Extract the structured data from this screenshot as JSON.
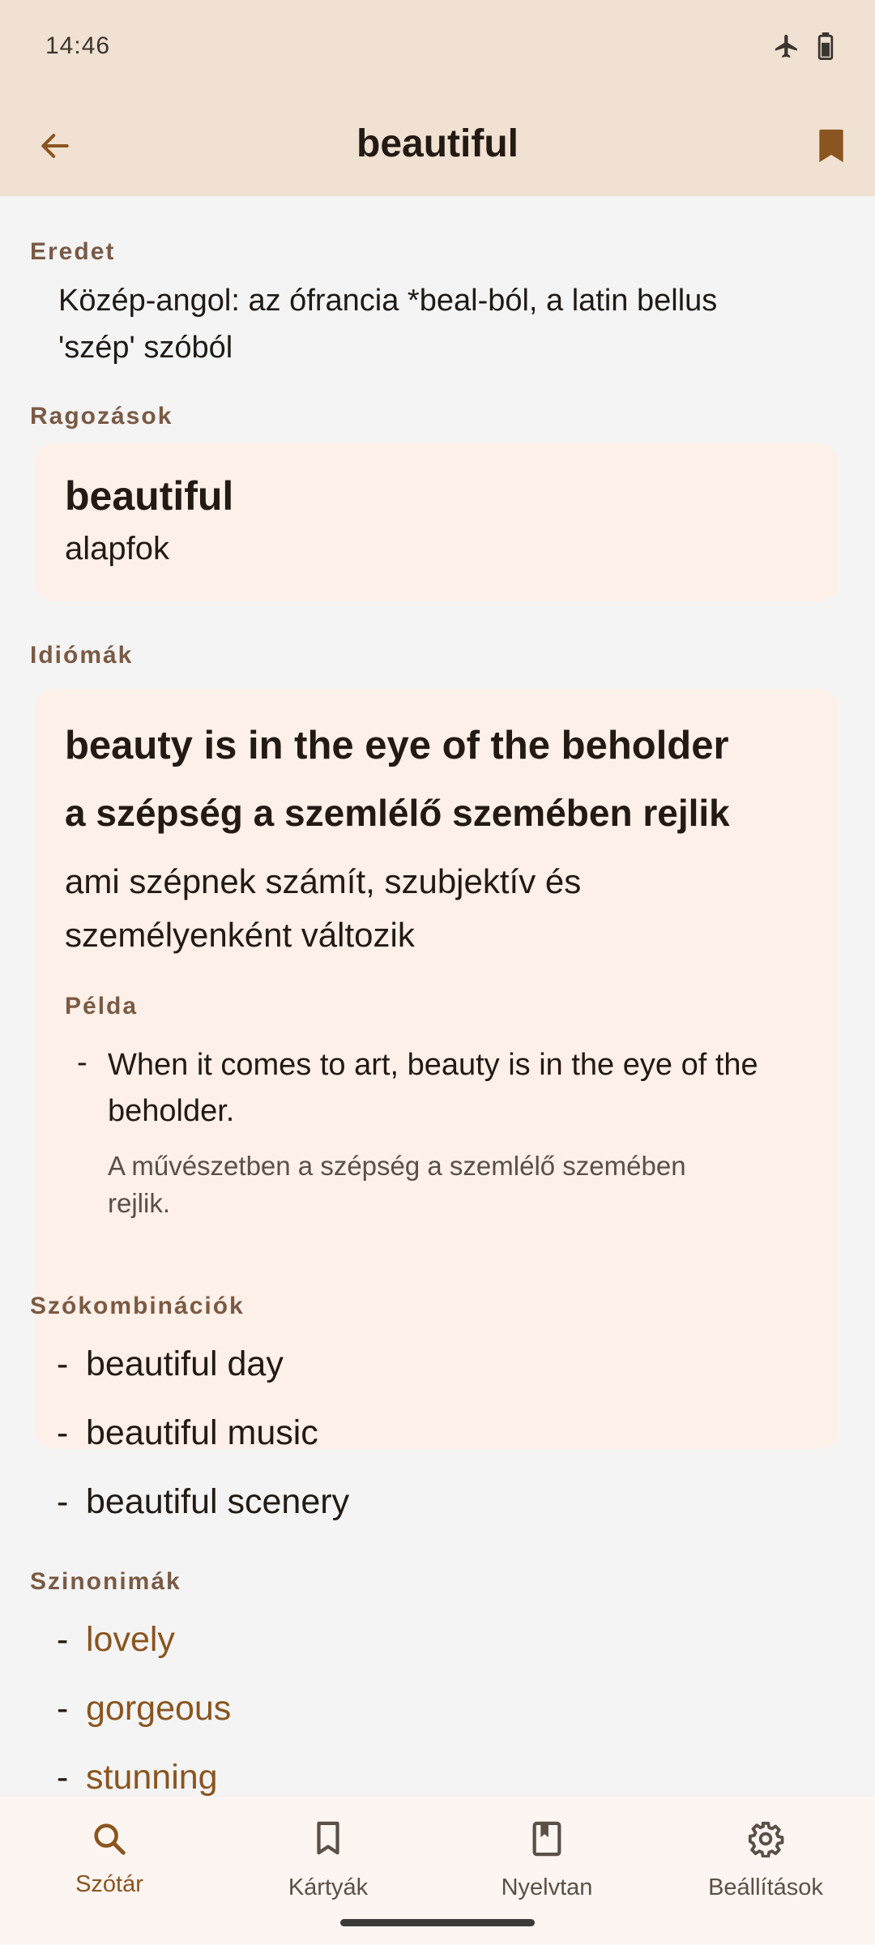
{
  "status": {
    "time": "14:46",
    "icons": [
      "airplane-icon",
      "battery-icon"
    ]
  },
  "header": {
    "title": "beautiful",
    "back_icon": "arrow-left-icon",
    "bookmark_icon": "bookmark-filled-icon"
  },
  "etymology": {
    "label": "Eredet",
    "line1": "Közép-angol: az ófrancia *beal-ból, a latin bellus",
    "line2": "'szép' szóból"
  },
  "inflections": {
    "label": "Ragozások",
    "word": "beautiful",
    "form": "alapfok"
  },
  "idioms": {
    "label": "Idiómák",
    "english": "beauty is in the eye of the beholder",
    "hungarian": "a szépség a szemlélő szemében rejlik",
    "definition_line1": "ami szépnek számít, szubjektív és",
    "definition_line2": "személyenként változik",
    "example_label": "Példa",
    "example_dash": "-",
    "example_en_line1": "When it comes to art, beauty is in the eye of the",
    "example_en_line2": "beholder.",
    "example_hu_line1": "A művészetben a szépség a szemlélő szemében",
    "example_hu_line2": "rejlik."
  },
  "collocations": {
    "label": "Szókombinációk",
    "dash": "-",
    "items": [
      "beautiful day",
      "beautiful music",
      "beautiful scenery"
    ]
  },
  "synonyms": {
    "label": "Szinonimák",
    "dash": "-",
    "items": [
      "lovely",
      "gorgeous",
      "stunning"
    ]
  },
  "nav": {
    "items": [
      {
        "label": "Szótár",
        "icon": "search-icon",
        "active": true
      },
      {
        "label": "Kártyák",
        "icon": "bookmark-icon",
        "active": false
      },
      {
        "label": "Nyelvtan",
        "icon": "book-icon",
        "active": false
      },
      {
        "label": "Beállítások",
        "icon": "gear-icon",
        "active": false
      }
    ]
  },
  "colors": {
    "header_bg": "#f1e1d2",
    "card_bg": "#fdf0e8",
    "accent": "#8a5520",
    "section_label": "#7a5a44"
  }
}
